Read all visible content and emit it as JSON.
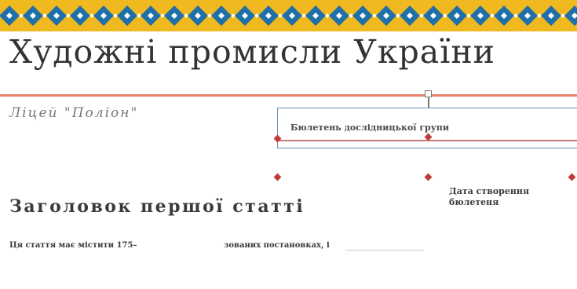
{
  "document": {
    "title": "Художні промисли України",
    "organization": "Ліцей \"Поліон\"",
    "textbox_text": "Бюлетень дослідницької групи",
    "article_heading": "Заголовок першої статті",
    "date_line1": "Дата створення",
    "date_line2": "бюлетеня",
    "body_col1": "Ця стаття має містити 175–",
    "body_col2": "зованих постановках, і"
  },
  "colors": {
    "band_yellow": "#efb91f",
    "band_blue": "#1f6fa8",
    "rule_salmon": "#e8806a",
    "handle_red": "#c13b3b"
  },
  "icons": {
    "rotate_handle": "rotate-handle-icon",
    "resize_handles": "resize-handle-icon"
  }
}
